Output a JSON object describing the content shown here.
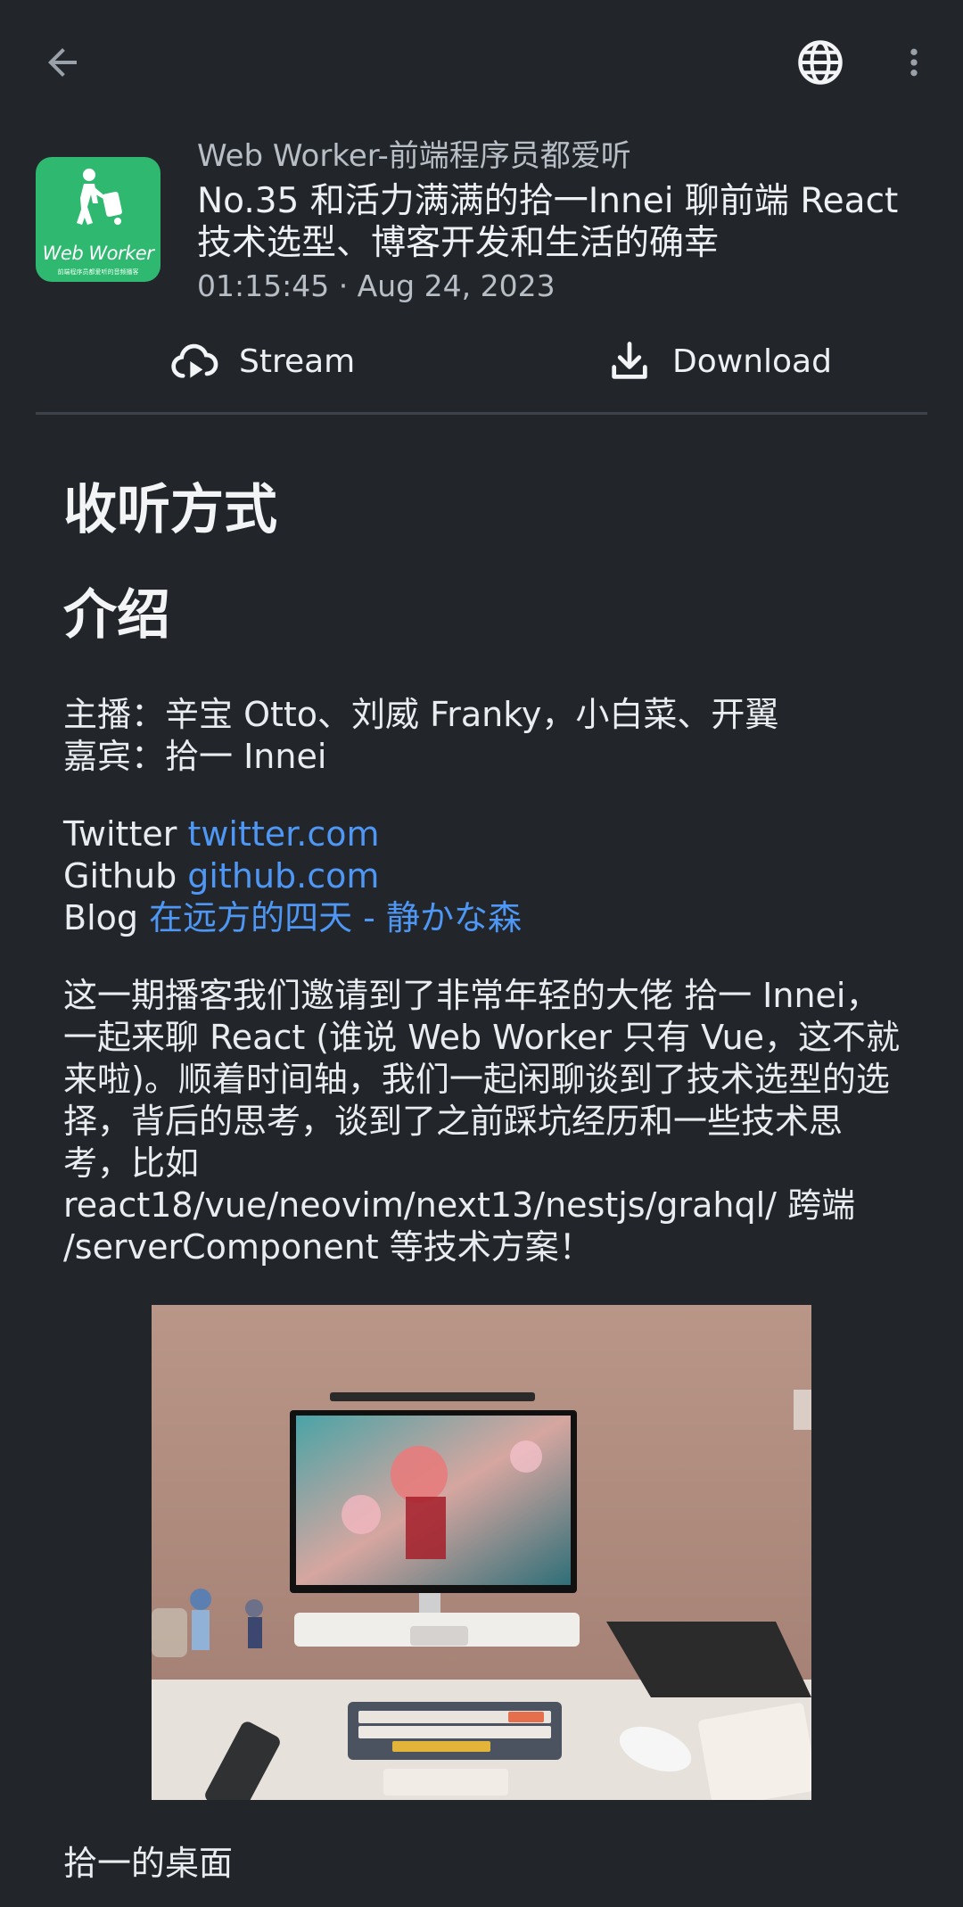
{
  "header": {
    "podcast_name": "Web Worker-前端程序员都爱听",
    "title": "No.35 和活力满满的拾一Innei 聊前端 React 技术选型、博客开发和生活的确幸",
    "meta": "01:15:45 · Aug 24, 2023",
    "logo_text": "Web Worker",
    "logo_subtext": "前端程序员都爱听的音频播客"
  },
  "actions": {
    "stream_label": "Stream",
    "download_label": "Download"
  },
  "content": {
    "heading1": "收听方式",
    "heading2": "介绍",
    "hosts_line": "主播：辛宝 Otto、刘威 Franky，小白菜、开翼",
    "guest_line": "嘉宾：拾一 Innei",
    "twitter_prefix": "Twitter ",
    "twitter_link": "twitter.com",
    "github_prefix": "Github ",
    "github_link": "github.com",
    "blog_prefix": "Blog ",
    "blog_link": "在远方的四天 - 静かな森",
    "description": "这一期播客我们邀请到了非常年轻的大佬 拾一 Innei，一起来聊 React (谁说 Web Worker 只有 Vue，这不就来啦)。顺着时间轴，我们一起闲聊谈到了技术选型的选择，背后的思考，谈到了之前踩坑经历和一些技术思考，比如 react18/vue/neovim/next13/nestjs/grahql/ 跨端 /serverComponent 等技术方案！",
    "photo_caption": "拾一的桌面"
  },
  "colors": {
    "background": "#22262b",
    "link": "#4e97f5",
    "logo": "#2fb86f"
  },
  "icons": [
    "back-arrow-icon",
    "globe-icon",
    "more-vert-icon",
    "cloud-stream-icon",
    "download-icon"
  ]
}
